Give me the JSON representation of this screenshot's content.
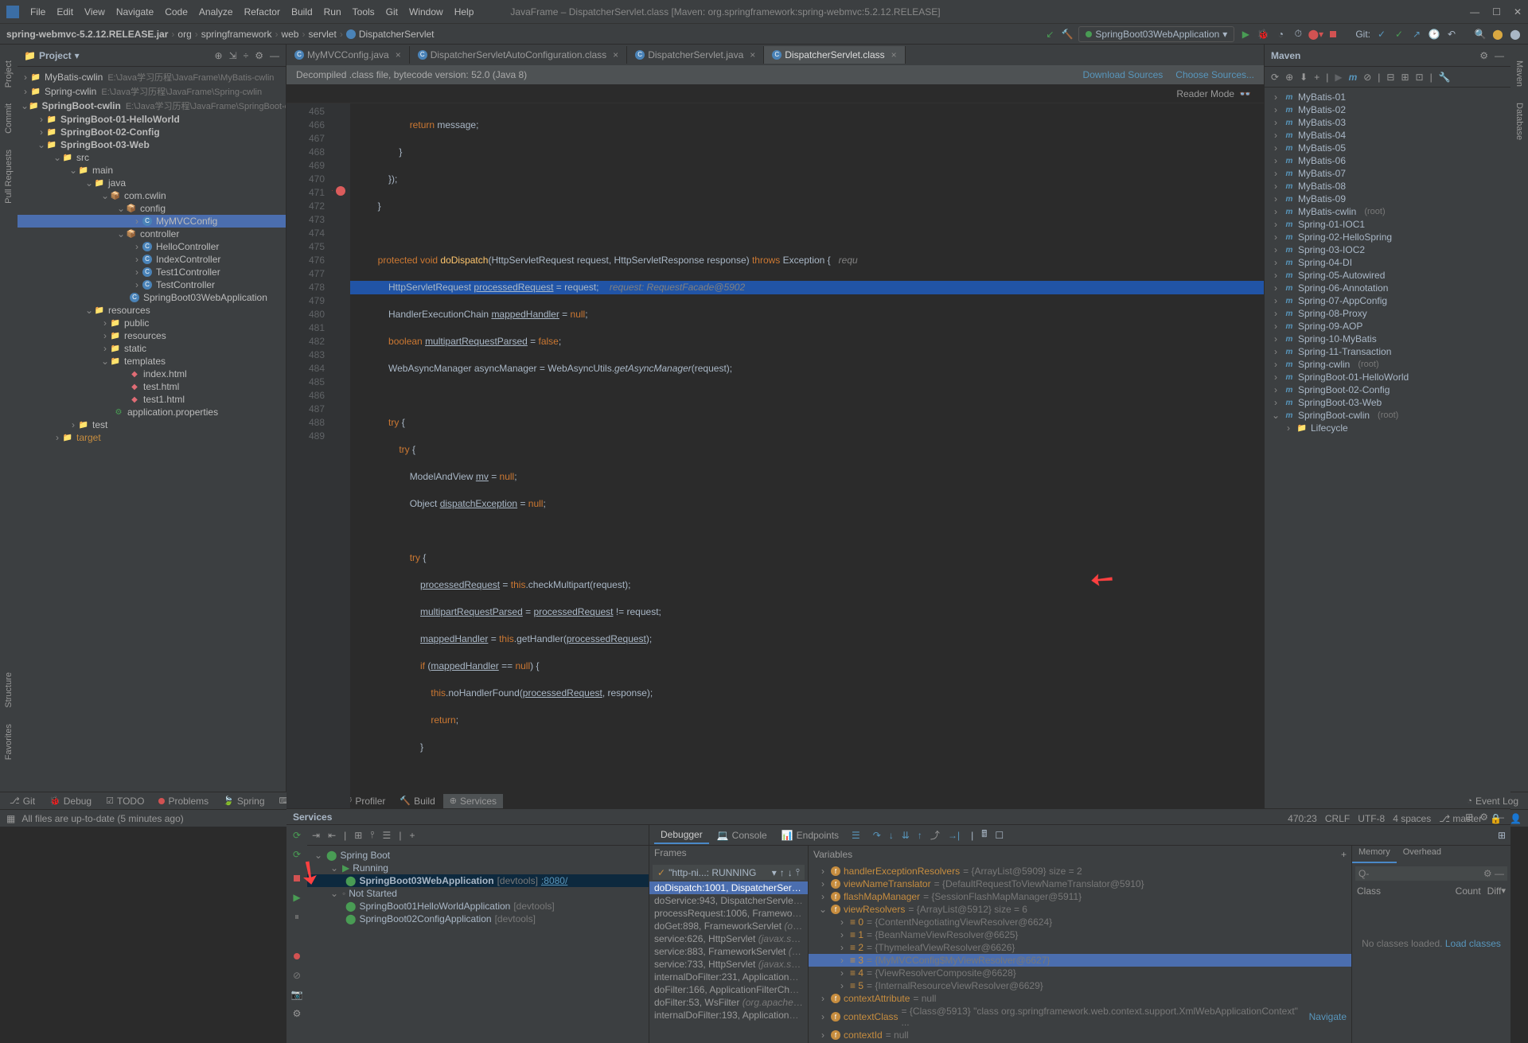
{
  "window": {
    "title": "JavaFrame – DispatcherServlet.class [Maven: org.springframework:spring-webmvc:5.2.12.RELEASE]"
  },
  "menu": [
    "File",
    "Edit",
    "View",
    "Navigate",
    "Code",
    "Analyze",
    "Refactor",
    "Build",
    "Run",
    "Tools",
    "Git",
    "Window",
    "Help"
  ],
  "breadcrumbs": {
    "jar": "spring-webmvc-5.2.12.RELEASE.jar",
    "pkg1": "org",
    "pkg2": "springframework",
    "pkg3": "web",
    "pkg4": "servlet",
    "cls": "DispatcherServlet"
  },
  "runConfig": "SpringBoot03WebApplication",
  "gitLabel": "Git:",
  "projectPanel": {
    "title": "Project",
    "roots": [
      {
        "name": "MyBatis-cwlin",
        "hint": "E:\\Java学习历程\\JavaFrame\\MyBatis-cwlin"
      },
      {
        "name": "Spring-cwlin",
        "hint": "E:\\Java学习历程\\JavaFrame\\Spring-cwlin"
      },
      {
        "name": "SpringBoot-cwlin",
        "hint": "E:\\Java学习历程\\JavaFrame\\SpringBoot-cwlin"
      }
    ],
    "modules": [
      "SpringBoot-01-HelloWorld",
      "SpringBoot-02-Config",
      "SpringBoot-03-Web"
    ],
    "src": "src",
    "main": "main",
    "java": "java",
    "pkg": "com.cwlin",
    "config": "config",
    "controller": "controller",
    "myconfig": "MyMVCConfig",
    "controllers": [
      "HelloController",
      "IndexController",
      "Test1Controller",
      "TestController"
    ],
    "app": "SpringBoot03WebApplication",
    "resources": "resources",
    "public": "public",
    "resources2": "resources",
    "static": "static",
    "templates": "templates",
    "files": [
      "index.html",
      "test.html",
      "test1.html"
    ],
    "props": "application.properties",
    "test": "test",
    "target": "target"
  },
  "editorTabs": [
    {
      "label": "MyMVCConfig.java",
      "icon": "class"
    },
    {
      "label": "DispatcherServletAutoConfiguration.class",
      "icon": "class"
    },
    {
      "label": "DispatcherServlet.java",
      "icon": "class"
    },
    {
      "label": "DispatcherServlet.class",
      "icon": "class",
      "active": true
    }
  ],
  "decompileMsg": "Decompiled .class file, bytecode version: 52.0 (Java 8)",
  "downloadSources": "Download Sources",
  "chooseSources": "Choose Sources...",
  "readerMode": "Reader Mode",
  "code": {
    "lines": [
      465,
      466,
      467,
      468,
      469,
      470,
      471,
      472,
      473,
      474,
      475,
      476,
      477,
      478,
      479,
      480,
      481,
      482,
      483,
      484,
      485,
      486,
      487,
      488,
      489
    ],
    "l465": "return message;",
    "l470_kw1": "protected void",
    "l470_m": "doDispatch",
    "l470_sig": "(HttpServletRequest request, HttpServletResponse response) ",
    "l470_kw2": "throws",
    "l470_end": " Exception {",
    "l470_hint": "   requ",
    "l471_a": "HttpServletRequest ",
    "l471_u": "processedRequest",
    "l471_b": " = request;",
    "l471_cmt": "    request: RequestFacade@5902",
    "l472_a": "HandlerExecutionChain ",
    "l472_u": "mappedHandler",
    "l472_b": " = ",
    "l472_kw": "null",
    "l472_c": ";",
    "l473_kw": "boolean ",
    "l473_u": "multipartRequestParsed",
    "l473_b": " = ",
    "l473_kw2": "false",
    "l473_c": ";",
    "l474_a": "WebAsyncManager asyncManager = WebAsyncUtils.",
    "l474_i": "getAsyncManager",
    "l474_b": "(request);",
    "l476": "try {",
    "l477": "try {",
    "l478_a": "ModelAndView ",
    "l478_u": "mv",
    "l478_b": " = ",
    "l478_kw": "null",
    "l478_c": ";",
    "l479_a": "Object ",
    "l479_u": "dispatchException",
    "l479_b": " = ",
    "l479_kw": "null",
    "l479_c": ";",
    "l481": "try {",
    "l482_u": "processedRequest",
    "l482_a": " = ",
    "l482_kw": "this",
    "l482_b": ".checkMultipart(request);",
    "l483_u": "multipartRequestParsed",
    "l483_a": " = ",
    "l483_u2": "processedRequest",
    "l483_b": " != request;",
    "l484_u": "mappedHandler",
    "l484_a": " = ",
    "l484_kw": "this",
    "l484_b": ".getHandler(",
    "l484_u2": "processedRequest",
    "l484_c": ");",
    "l485_kw": "if",
    "l485_a": " (",
    "l485_u": "mappedHandler",
    "l485_b": " == ",
    "l485_kw2": "null",
    "l485_c": ") {",
    "l486_kw": "this",
    "l486_a": ".noHandlerFound(",
    "l486_u": "processedRequest",
    "l486_b": ", response);",
    "l487_kw": "return",
    "l487_a": ";",
    "l488": "}"
  },
  "mavenTitle": "Maven",
  "mavenProjects": [
    "MyBatis-01",
    "MyBatis-02",
    "MyBatis-03",
    "MyBatis-04",
    "MyBatis-05",
    "MyBatis-06",
    "MyBatis-07",
    "MyBatis-08",
    "MyBatis-09"
  ],
  "mavenRoot1": {
    "name": "MyBatis-cwlin",
    "hint": "(root)"
  },
  "mavenProjects2": [
    "Spring-01-IOC1",
    "Spring-02-HelloSpring",
    "Spring-03-IOC2",
    "Spring-04-DI",
    "Spring-05-Autowired",
    "Spring-06-Annotation",
    "Spring-07-AppConfig",
    "Spring-08-Proxy",
    "Spring-09-AOP",
    "Spring-10-MyBatis",
    "Spring-11-Transaction"
  ],
  "mavenRoot2": {
    "name": "Spring-cwlin",
    "hint": "(root)"
  },
  "mavenBoot": [
    "SpringBoot-01-HelloWorld",
    "SpringBoot-02-Config",
    "SpringBoot-03-Web"
  ],
  "mavenRoot3": {
    "name": "SpringBoot-cwlin",
    "hint": "(root)"
  },
  "lifecycle": "Lifecycle",
  "servicesTitle": "Services",
  "sb": "Spring Boot",
  "running": "Running",
  "sbApp": "SpringBoot03WebApplication",
  "sbDev": "[devtools]",
  "sbPort": ":8080/",
  "notStarted": "Not Started",
  "sbApp1": "SpringBoot01HelloWorldApplication",
  "sbApp1Dev": "[devtools]",
  "sbApp2": "SpringBoot02ConfigApplication",
  "sbApp2Dev": "[devtools]",
  "debugger": "Debugger",
  "console": "Console",
  "endpoints": "Endpoints",
  "framesTitle": "Frames",
  "threadCombo": "\"http-ni...: RUNNING",
  "frames": [
    {
      "m": "doDispatch:1001, DispatcherServlet",
      "h": "(org...",
      "active": true
    },
    {
      "m": "doService:943, DispatcherServlet",
      "h": "(org.s..."
    },
    {
      "m": "processRequest:1006, FrameworkServlet",
      "h": ""
    },
    {
      "m": "doGet:898, FrameworkServlet",
      "h": "(org.spring..."
    },
    {
      "m": "service:626, HttpServlet",
      "h": "(javax.servlet.htt..."
    },
    {
      "m": "service:883, FrameworkServlet",
      "h": "(org.sprin..."
    },
    {
      "m": "service:733, HttpServlet",
      "h": "(javax.servlet.htt..."
    },
    {
      "m": "internalDoFilter:231, ApplicationFilterChai",
      "h": ""
    },
    {
      "m": "doFilter:166, ApplicationFilterChain",
      "h": "(org.a..."
    },
    {
      "m": "doFilter:53, WsFilter",
      "h": "(org.apache.tomcat..."
    },
    {
      "m": "internalDoFilter:193, ApplicationFilterChai",
      "h": ""
    }
  ],
  "varsTitle": "Variables",
  "vars": [
    {
      "t": "f",
      "name": "handlerExceptionResolvers",
      "val": " = {ArrayList@5909}  size = 2"
    },
    {
      "t": "f",
      "name": "viewNameTranslator",
      "val": " = {DefaultRequestToViewNameTranslator@5910}"
    },
    {
      "t": "f",
      "name": "flashMapManager",
      "val": " = {SessionFlashMapManager@5911}"
    },
    {
      "t": "f",
      "name": "viewResolvers",
      "val": " = {ArrayList@5912}  size = 6",
      "expanded": true,
      "children": [
        {
          "name": "0",
          "val": " = {ContentNegotiatingViewResolver@6624}"
        },
        {
          "name": "1",
          "val": " = {BeanNameViewResolver@6625}"
        },
        {
          "name": "2",
          "val": " = {ThymeleafViewResolver@6626}"
        },
        {
          "name": "3",
          "val": " = {MyMVCConfig$MyViewResolver@6627}",
          "sel": true
        },
        {
          "name": "4",
          "val": " = {ViewResolverComposite@6628}"
        },
        {
          "name": "5",
          "val": " = {InternalResourceViewResolver@6629}"
        }
      ]
    },
    {
      "t": "f",
      "name": "contextAttribute",
      "val": " = null"
    },
    {
      "t": "f",
      "name": "contextClass",
      "val": " = {Class@5913} \"class org.springframework.web.context.support.XmlWebApplicationContext\" ...",
      "navigate": "Navigate"
    },
    {
      "t": "f",
      "name": "contextId",
      "val": " = null"
    }
  ],
  "memTabs": {
    "memory": "Memory",
    "overhead": "Overhead"
  },
  "memPlaceholder": "Q-",
  "memCols": {
    "class": "Class",
    "count": "Count",
    "diff": "Diff"
  },
  "memHint": "No classes loaded. ",
  "memLink": "Load classes",
  "statusTabs": {
    "git": "Git",
    "debug": "Debug",
    "todo": "TODO",
    "problems": "Problems",
    "spring": "Spring",
    "terminal": "Terminal",
    "profiler": "Profiler",
    "build": "Build",
    "services": "Services"
  },
  "eventLog": "Event Log",
  "statusMsg": "All files are up-to-date (5 minutes ago)",
  "cursor": "470:23",
  "crlf": "CRLF",
  "enc": "UTF-8",
  "spaces": "4 spaces",
  "branch": "master",
  "leftStrip": [
    "Commit",
    "Project",
    "Pull Requests",
    "Structure",
    "Favorites"
  ],
  "rightStrip": [
    "Maven",
    "Database"
  ]
}
